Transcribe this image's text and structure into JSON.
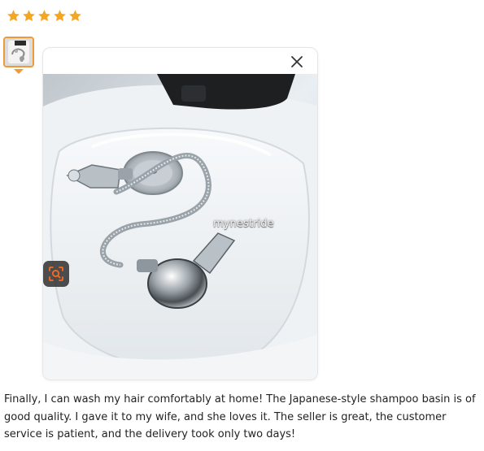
{
  "rating": {
    "stars_filled": 5,
    "stars_total": 5,
    "star_color": "#f5a623"
  },
  "thumbnail": {
    "selected": true,
    "border_color": "#f09a37"
  },
  "viewer": {
    "close_icon": "close-icon",
    "watermark": "mynestride",
    "lens_icon": "visual-search-icon",
    "lens_color": "#ff6a1a"
  },
  "review": {
    "text": "Finally, I can wash my hair comfortably at home! The Japanese-style shampoo basin is of good quality. I gave it to my wife, and she loves it. The seller is great, the customer service is patient, and the delivery took only two days!"
  }
}
